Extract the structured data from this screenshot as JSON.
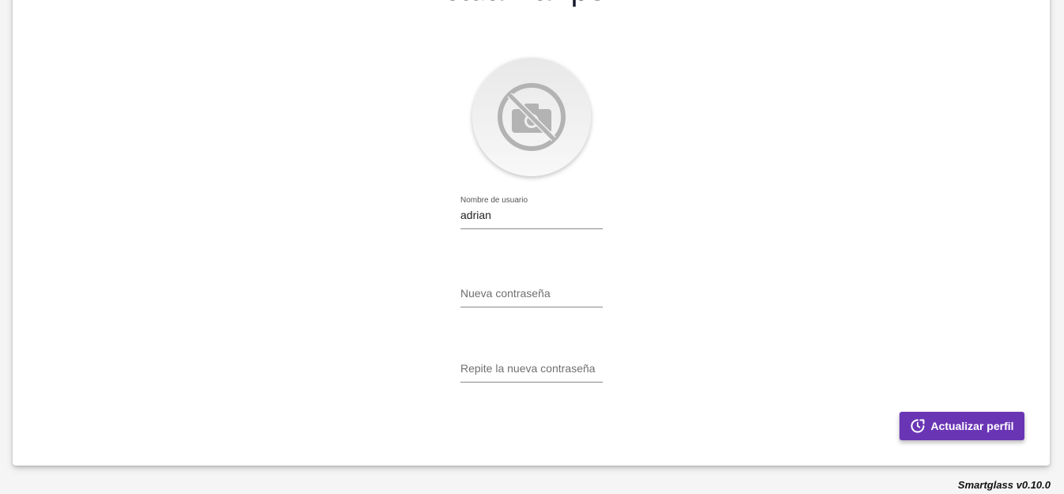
{
  "page": {
    "title": "Actualizar perfil"
  },
  "avatar": {
    "icon": "no-photo-camera-icon"
  },
  "form": {
    "username": {
      "label": "Nombre de usuario",
      "value": "adrian"
    },
    "new_password": {
      "placeholder": "Nueva contraseña"
    },
    "repeat_password": {
      "placeholder": "Repite la nueva contraseña"
    }
  },
  "actions": {
    "update_label": "Actualizar perfil",
    "update_icon": "refresh-clock-icon"
  },
  "footer": {
    "version": "Smartglass v0.10.0"
  },
  "colors": {
    "accent": "#6a35b5",
    "background": "#f5f5f5",
    "card": "#ffffff"
  }
}
